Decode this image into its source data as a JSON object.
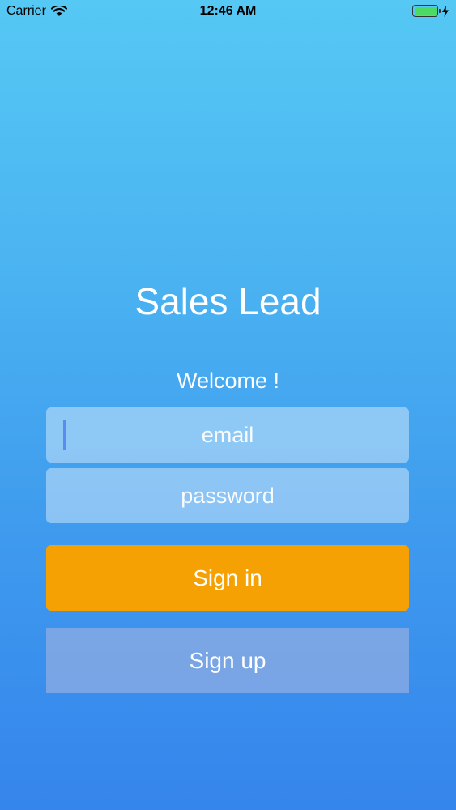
{
  "status_bar": {
    "carrier": "Carrier",
    "time": "12:46 AM",
    "battery_level": 1.0
  },
  "app_title": "Sales Lead",
  "welcome": "Welcome !",
  "email_field": {
    "placeholder": "email",
    "value": ""
  },
  "password_field": {
    "placeholder": "password",
    "value": ""
  },
  "signin_label": "Sign in",
  "signup_label": "Sign up",
  "colors": {
    "background_top": "#55c8f4",
    "background_bottom": "#3585ec",
    "signin_button": "#f6a103",
    "battery": "#4cd964"
  },
  "icons": [
    "wifi-icon",
    "battery-icon",
    "charging-icon"
  ]
}
